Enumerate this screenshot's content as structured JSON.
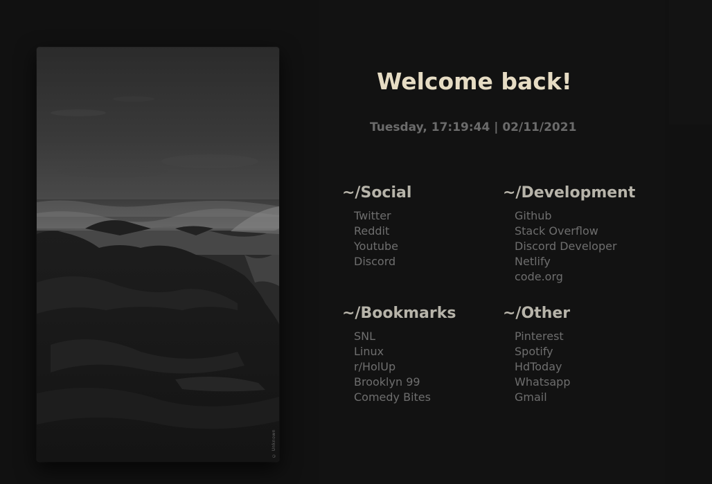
{
  "photo": {
    "description": "grayscale rocky seashore with crashing waves",
    "credit": "© Unknown"
  },
  "header": {
    "greeting": "Welcome back!",
    "datetime": "Tuesday, 17:19:44 | 02/11/2021"
  },
  "sections": {
    "social": {
      "title": "~/Social",
      "links": [
        "Twitter",
        "Reddit",
        "Youtube",
        "Discord"
      ]
    },
    "development": {
      "title": "~/Development",
      "links": [
        "Github",
        "Stack Overflow",
        "Discord Developer",
        "Netlify",
        "code.org"
      ]
    },
    "bookmarks": {
      "title": "~/Bookmarks",
      "links": [
        "SNL",
        "Linux",
        "r/HolUp",
        "Brooklyn 99",
        "Comedy Bites"
      ]
    },
    "other": {
      "title": "~/Other",
      "links": [
        "Pinterest",
        "Spotify",
        "HdToday",
        "Whatsapp",
        "Gmail"
      ]
    }
  },
  "colors": {
    "background": "#111111",
    "greeting": "#e6dcc4",
    "section_title": "#b7b4aa",
    "link": "#6e6e6e",
    "datetime": "#6b6b6b"
  }
}
